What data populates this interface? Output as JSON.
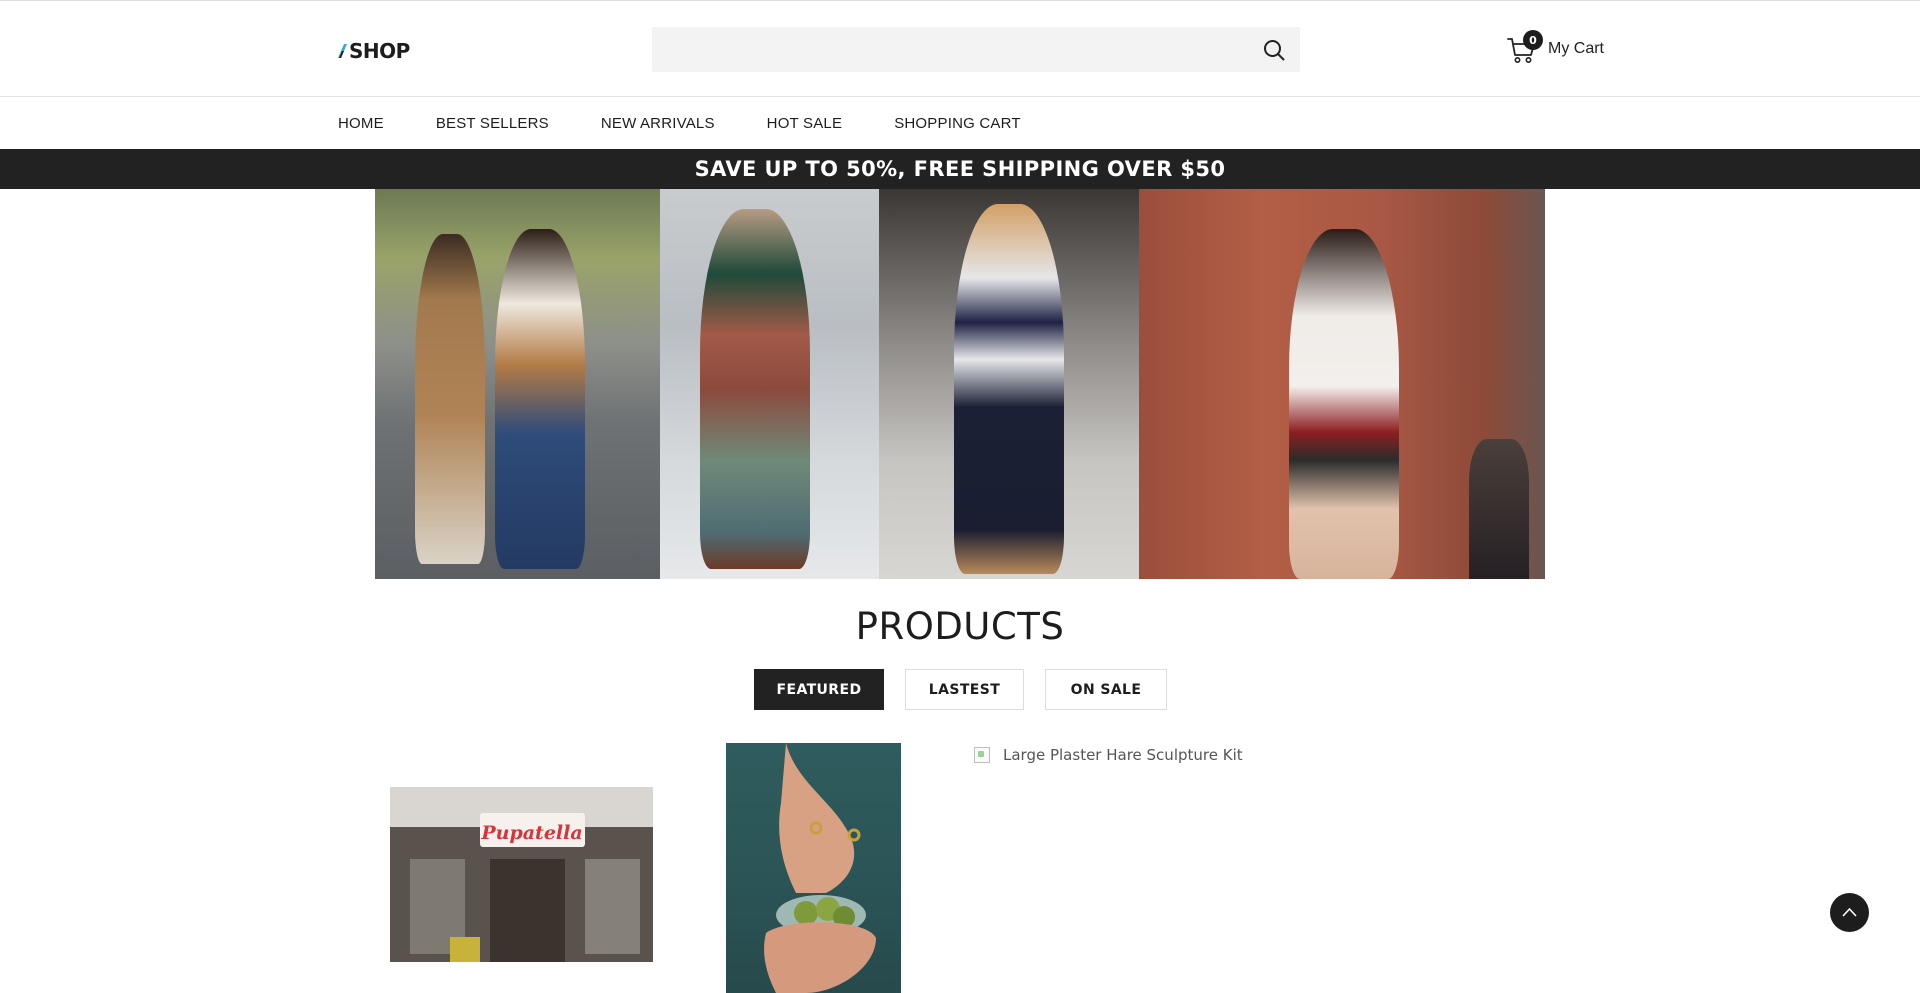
{
  "header": {
    "logo_text": "SHOP",
    "search": {
      "placeholder": "",
      "value": "",
      "icon": "search-icon"
    },
    "cart": {
      "count": "0",
      "label": "My Cart",
      "icon": "cart-icon"
    }
  },
  "nav": {
    "items": [
      {
        "label": "HOME"
      },
      {
        "label": "BEST SELLERS"
      },
      {
        "label": "NEW ARRIVALS"
      },
      {
        "label": "HOT SALE"
      },
      {
        "label": "SHOPPING CART"
      }
    ]
  },
  "promo": {
    "text": "SAVE UP TO 50%, FREE SHIPPING OVER $50"
  },
  "products": {
    "title": "PRODUCTS",
    "tabs": [
      {
        "label": "FEATURED",
        "active": true
      },
      {
        "label": "LASTEST",
        "active": false
      },
      {
        "label": "ON SALE",
        "active": false
      }
    ],
    "items": [
      {
        "image_alt": "storefront"
      },
      {
        "image_alt": "hands with olives"
      },
      {
        "image_alt": "Large Plaster Hare Sculpture Kit"
      }
    ]
  },
  "colors": {
    "dark": "#222222",
    "accent_logo": "#3aa7d8"
  }
}
